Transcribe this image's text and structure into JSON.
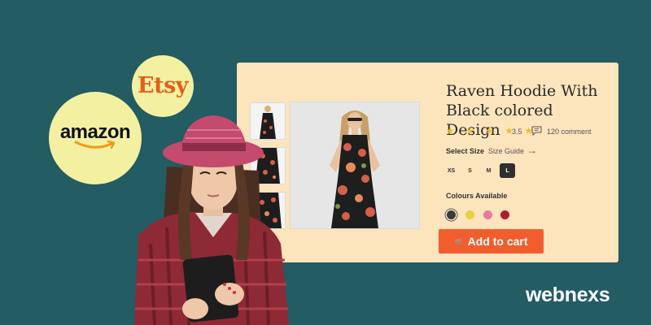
{
  "logos": {
    "etsy": "Etsy",
    "amazon": "amazon",
    "brand": "webnexs"
  },
  "product": {
    "title": "Raven Hoodie With Black colored Design",
    "stars": "★ ★ ★ ★ ★",
    "rating": "3.5",
    "comments": "120 comment",
    "select_size_label": "Select Size",
    "size_guide_label": "Size Guide",
    "arrow": "→",
    "sizes": [
      "XS",
      "S",
      "M",
      "L"
    ],
    "selected_size": "L",
    "colours_label": "Colours Available",
    "colours": [
      "#3a3a3a",
      "#e8d23a",
      "#e87aa6",
      "#b01c28"
    ],
    "add_to_cart_label": "Add to cart",
    "cart_icon": "🛒"
  },
  "colors": {
    "background": "#235c63",
    "card": "#fce4bd",
    "accent": "#f25d2d",
    "bubble": "#f3f0a2"
  }
}
